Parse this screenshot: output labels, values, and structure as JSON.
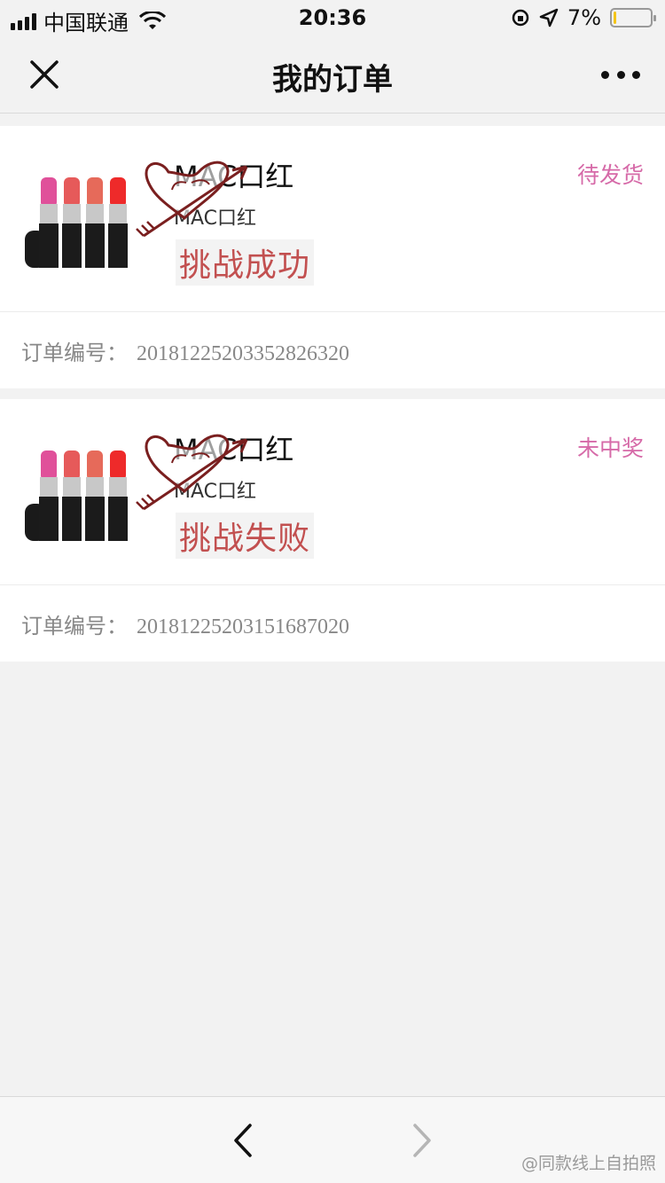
{
  "status_bar": {
    "carrier": "中国联通",
    "time": "20:36",
    "battery": "7%",
    "battery_level": 0.07
  },
  "nav": {
    "title": "我的订单"
  },
  "orders": [
    {
      "product_name": "MAC口红",
      "product_subtitle": "MAC口红",
      "status": "待发货",
      "challenge_text": "挑战成功",
      "order_label": "订单编号：",
      "order_number": "20181225203352826320"
    },
    {
      "product_name": "MAC口红",
      "product_subtitle": "MAC口红",
      "status": "未中奖",
      "challenge_text": "挑战失败",
      "order_label": "订单编号：",
      "order_number": "20181225203151687020"
    }
  ],
  "watermark": "@同款线上自拍照",
  "colors": {
    "status_pink": "#d66aa8",
    "challenge_red": "#c25050",
    "heart_brown": "#7a1f1f"
  }
}
